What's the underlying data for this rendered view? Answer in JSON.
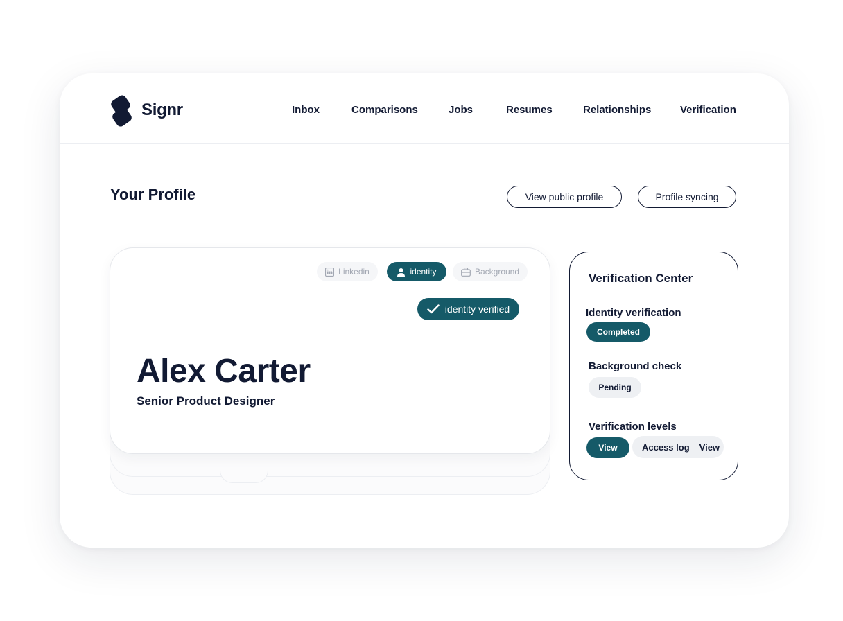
{
  "app": {
    "name": "Signr",
    "brand_color": "#121a33",
    "accent_color": "#155a68"
  },
  "nav": {
    "items": [
      {
        "label": "Inbox"
      },
      {
        "label": "Comparisons"
      },
      {
        "label": "Jobs"
      },
      {
        "label": "Resumes"
      },
      {
        "label": "Relationships"
      },
      {
        "label": "Verification"
      }
    ]
  },
  "page": {
    "title": "Your Profile",
    "view_public_profile_label": "View public profile",
    "profile_syncing_label": "Profile syncing"
  },
  "profile_card": {
    "tabs": [
      {
        "label": "Linkedin",
        "icon": "linkedin-icon",
        "active": false
      },
      {
        "label": "identity",
        "icon": "user-icon",
        "active": true
      },
      {
        "label": "Background",
        "icon": "briefcase-icon",
        "active": false
      }
    ],
    "verified_badge": "identity verified",
    "name": "Alex Carter",
    "role": "Senior Product Designer"
  },
  "verification_center": {
    "title": "Verification Center",
    "identity": {
      "label": "Identity verification",
      "status": "Completed"
    },
    "background": {
      "label": "Background check",
      "status": "Pending"
    },
    "levels": {
      "label": "Verification levels",
      "view_label": "View",
      "access_log_label": "Access log",
      "access_log_view_label": "View"
    }
  }
}
